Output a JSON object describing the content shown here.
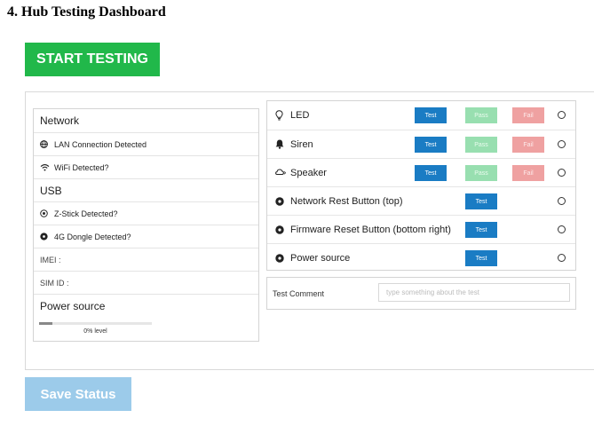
{
  "page": {
    "title": "4. Hub Testing Dashboard"
  },
  "actions": {
    "start_label": "START TESTING",
    "save_label": "Save Status"
  },
  "status_panel": {
    "network_heading": "Network",
    "lan_label": "LAN Connection Detected",
    "wifi_label": "WiFi Detected?",
    "usb_heading": "USB",
    "zstick_label": "Z-Stick Detected?",
    "dongle_label": "4G Dongle Detected?",
    "imei_label": "IMEI :",
    "simid_label": "SIM ID :",
    "power_heading": "Power source",
    "power_level_text": "0% level",
    "power_level_fraction": 0.12
  },
  "tests": {
    "test_label": "Test",
    "pass_label": "Pass",
    "fail_label": "Fail",
    "rows": [
      {
        "label": "LED",
        "icon": "lightbulb-icon"
      },
      {
        "label": "Siren",
        "icon": "bell-icon"
      },
      {
        "label": "Speaker",
        "icon": "speaker-icon"
      },
      {
        "label": "Network Rest Button (top)",
        "icon": "dot-circle-icon"
      },
      {
        "label": "Firmware Reset Button (bottom right)",
        "icon": "dot-circle-icon"
      },
      {
        "label": "Power source",
        "icon": "dot-circle-icon"
      }
    ]
  },
  "comment": {
    "label": "Test Comment",
    "placeholder": "type something about the test"
  },
  "colors": {
    "start": "#21b84a",
    "test": "#1a7cc4",
    "pass": "#98dfb0",
    "fail": "#efa1a1",
    "save": "#9ccbea"
  }
}
